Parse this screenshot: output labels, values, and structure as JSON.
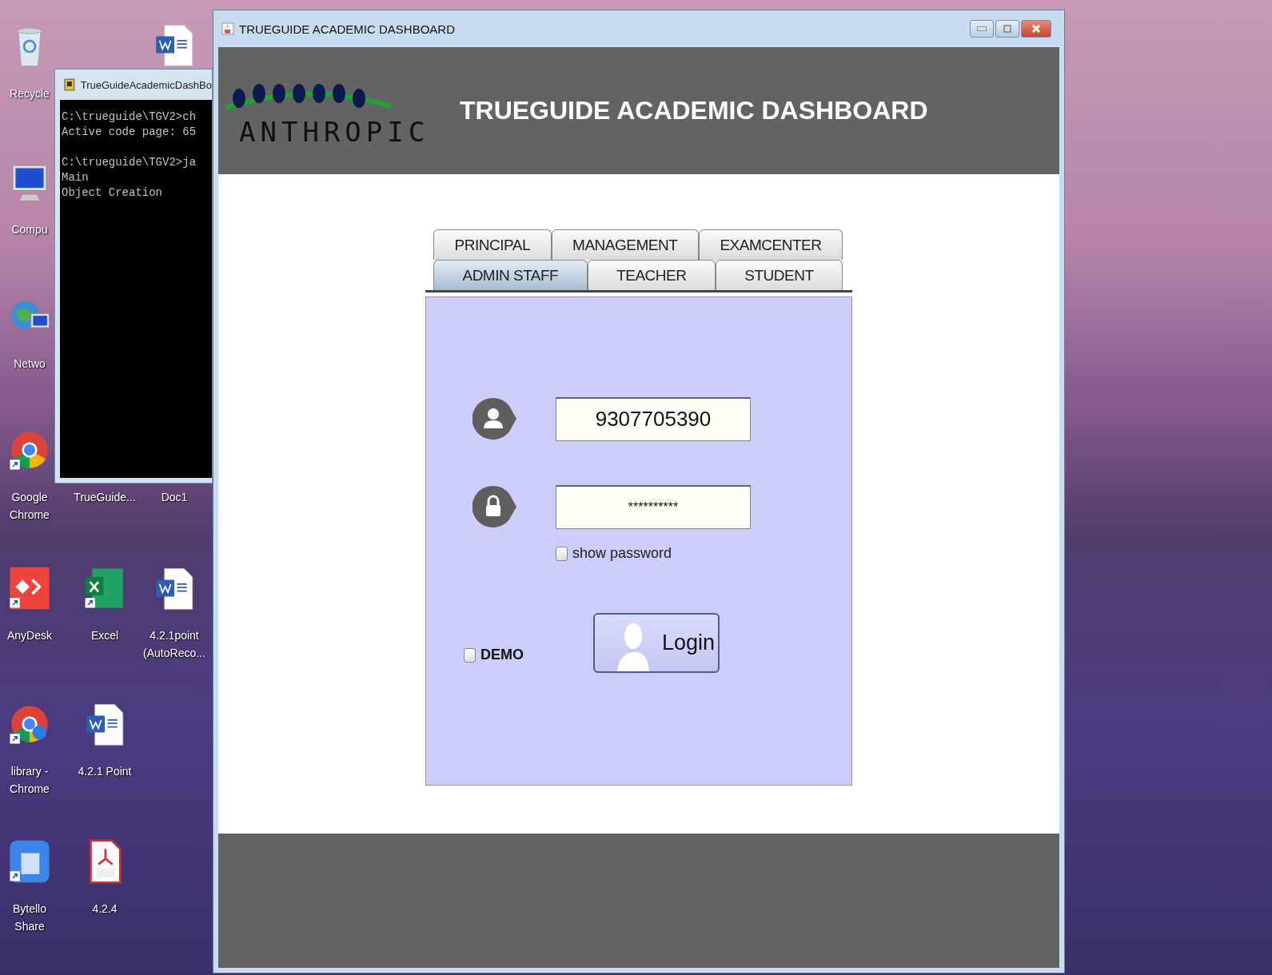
{
  "desktop": {
    "icons": [
      {
        "kind": "recycle",
        "label": "Recycle"
      },
      {
        "kind": "word"
      },
      {
        "kind": "computer",
        "label": "Compu"
      },
      {
        "kind": "network",
        "label": "Netwo"
      },
      {
        "kind": "chrome",
        "label": "Google Chrome"
      },
      {
        "kind": "covered",
        "label": "TrueGuide..."
      },
      {
        "kind": "covered",
        "label": "Doc1"
      },
      {
        "kind": "anydesk",
        "label": "AnyDesk"
      },
      {
        "kind": "excel",
        "label": "Excel"
      },
      {
        "kind": "word",
        "label": "4.2.1point (AutoReco..."
      },
      {
        "kind": "chrome-app",
        "label": "library - Chrome"
      },
      {
        "kind": "word",
        "label": "4.2.1 Point"
      },
      {
        "kind": "bytello",
        "label": "Bytello Share"
      },
      {
        "kind": "pdf",
        "label": "4.2.4"
      }
    ]
  },
  "console_window": {
    "title": "TrueGuideAcademicDashBo",
    "blocks": [
      [
        "C:\\trueguide\\TGV2>ch",
        "Active code page: 65"
      ],
      [
        "C:\\trueguide\\TGV2>ja",
        "Main",
        "Object Creation"
      ]
    ]
  },
  "app_window": {
    "title": "TRUEGUIDE ACADEMIC DASHBOARD",
    "header": {
      "logo_text": "ANTHROPIC",
      "title": "TRUEGUIDE ACADEMIC DASHBOARD"
    },
    "tab_rows": [
      [
        {
          "label": "PRINCIPAL",
          "selected": false
        },
        {
          "label": "MANAGEMENT",
          "selected": false
        },
        {
          "label": "EXAMCENTER",
          "selected": false
        }
      ],
      [
        {
          "label": "ADMIN STAFF",
          "selected": true
        },
        {
          "label": "TEACHER",
          "selected": false
        },
        {
          "label": "STUDENT",
          "selected": false
        }
      ]
    ],
    "login": {
      "user_id": "9307705390",
      "password": "**********",
      "show_password": {
        "label": "show password",
        "checked": false
      },
      "demo": {
        "label": "DEMO",
        "checked": false
      },
      "button": "Login"
    }
  }
}
